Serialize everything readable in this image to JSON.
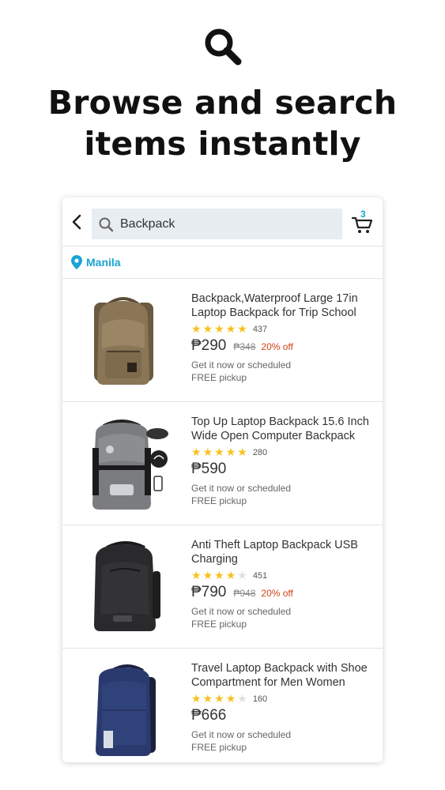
{
  "hero": {
    "icon": "search-icon",
    "headline_line1": "Browse and search",
    "headline_line2": "items instantly"
  },
  "topbar": {
    "back_icon": "chevron-left-icon",
    "search_value": "Backpack",
    "cart_icon": "cart-icon",
    "cart_count": "3"
  },
  "location": {
    "icon": "map-pin-icon",
    "label": "Manila"
  },
  "colors": {
    "accent": "#1aa3d4",
    "star": "#f7c11d",
    "discount": "#d0421b"
  },
  "products": [
    {
      "title_line1": "Backpack,Waterproof Large 17in",
      "title_line2": "Laptop Backpack for Trip School",
      "stars": 5,
      "reviews": "437",
      "price": "₱290",
      "old_price": "₱348",
      "discount": "20% off",
      "note1": "Get it now or scheduled",
      "note2": "FREE pickup"
    },
    {
      "title_line1": "Top Up Laptop Backpack 15.6 Inch",
      "title_line2": "Wide Open Computer Backpack",
      "stars": 5,
      "reviews": "280",
      "price": "₱590",
      "old_price": "",
      "discount": "",
      "note1": "Get it now or scheduled",
      "note2": "FREE pickup"
    },
    {
      "title_line1": "Anti Theft Laptop Backpack USB",
      "title_line2": "Charging",
      "stars": 4,
      "reviews": "451",
      "price": "₱790",
      "old_price": "₱948",
      "discount": "20% off",
      "note1": "Get it now or scheduled",
      "note2": "FREE pickup"
    },
    {
      "title_line1": "Travel Laptop Backpack with Shoe",
      "title_line2": "Compartment for Men Women",
      "stars": 4,
      "reviews": "160",
      "price": "₱666",
      "old_price": "",
      "discount": "",
      "note1": "Get it now or scheduled",
      "note2": "FREE pickup"
    }
  ]
}
